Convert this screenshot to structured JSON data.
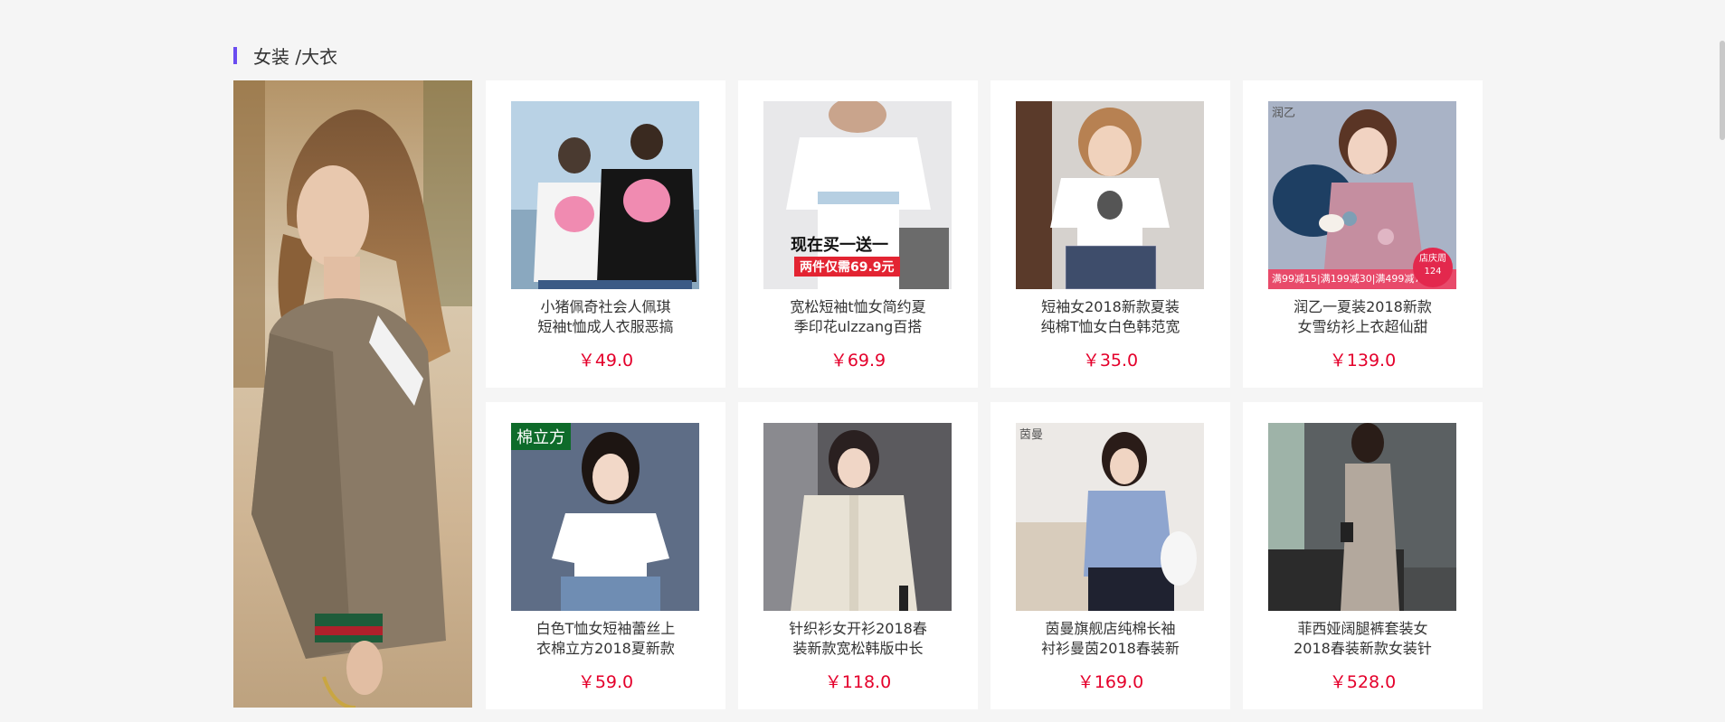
{
  "section": {
    "title": "女装 /大衣"
  },
  "banner": {
    "alt": "model-in-plaid-blazer"
  },
  "products": [
    {
      "name": "小猪佩奇社会人佩琪\n短袖t恤成人衣服恶搞",
      "price": "￥49.0",
      "image": {
        "badge": "",
        "overlay": "",
        "promo": ""
      }
    },
    {
      "name": "宽松短袖t恤女简约夏\n季印花ulzzang百搭",
      "price": "￥69.9",
      "image": {
        "overlay_title": "现在买一送一",
        "overlay_sub": "两件仅需69.9元"
      }
    },
    {
      "name": "短袖女2018新款夏装\n纯棉T恤女白色韩范宽",
      "price": "￥35.0",
      "image": {}
    },
    {
      "name": "润乙一夏装2018新款\n女雪纺衫上衣超仙甜",
      "price": "￥139.0",
      "image": {
        "brand": "润乙",
        "promo_bar": "满99减15|满199减30|满499减75",
        "circle_top": "店庆周",
        "circle_num": "124"
      }
    },
    {
      "name": "白色T恤女短袖蕾丝上\n衣棉立方2018夏新款",
      "price": "￥59.0",
      "image": {
        "badge": "棉立方"
      }
    },
    {
      "name": "针织衫女开衫2018春\n装新款宽松韩版中长",
      "price": "￥118.0",
      "image": {}
    },
    {
      "name": "茵曼旗舰店纯棉长袖\n衬衫曼茵2018春装新",
      "price": "￥169.0",
      "image": {
        "brand": "茵曼"
      }
    },
    {
      "name": "菲西娅阔腿裤套装女\n2018春装新款女装针",
      "price": "￥528.0",
      "image": {}
    }
  ]
}
